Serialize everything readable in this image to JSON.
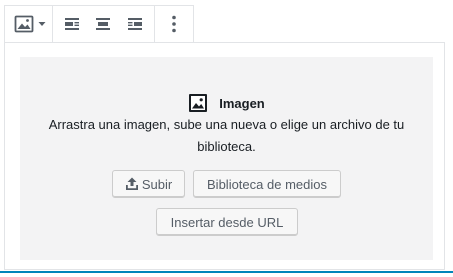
{
  "toolbar": {
    "items": [
      {
        "name": "image-type",
        "icon": "image-icon"
      },
      {
        "name": "align-left",
        "icon": "align-left-icon"
      },
      {
        "name": "align-center",
        "icon": "align-center-icon"
      },
      {
        "name": "align-right",
        "icon": "align-right-icon"
      },
      {
        "name": "more-options",
        "icon": "ellipsis-vertical-icon"
      }
    ]
  },
  "placeholder": {
    "title": "Imagen",
    "instructions": "Arrastra una imagen, sube una nueva o elige un archivo de tu biblioteca.",
    "upload_label": "Subir",
    "media_library_label": "Biblioteca de medios",
    "insert_url_label": "Insertar desde URL"
  },
  "colors": {
    "accent": "#0085ba",
    "placeholder_bg": "#f3f3f4",
    "text": "#191e23",
    "button_text": "#555d66"
  }
}
